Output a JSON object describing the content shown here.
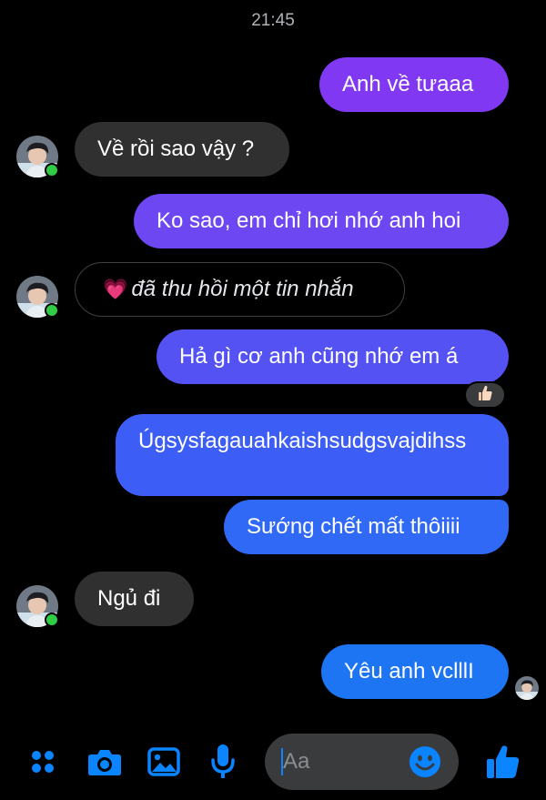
{
  "status": {
    "time": "21:45"
  },
  "messages": [
    {
      "id": "m1",
      "side": "outgoing",
      "text": "Anh về tưaaa"
    },
    {
      "id": "m2",
      "side": "incoming",
      "text": "Về rồi sao vậy ?"
    },
    {
      "id": "m3",
      "side": "outgoing",
      "text": "Ko sao, em chỉ hơi nhớ anh hoi"
    },
    {
      "id": "m4",
      "side": "incoming",
      "unsent": true,
      "emoji": "💗",
      "text": "đã thu hồi một tin nhắn"
    },
    {
      "id": "m5",
      "side": "outgoing",
      "text": "Hả gì cơ anh cũng nhớ em á",
      "reaction": "thumbs-up"
    },
    {
      "id": "m6",
      "side": "outgoing",
      "text": "Úgsysfagauahkaishsudgsvajdihss"
    },
    {
      "id": "m7",
      "side": "outgoing",
      "text": "Sướng chết mất thôiiii"
    },
    {
      "id": "m8",
      "side": "incoming",
      "text": "Ngủ đi"
    },
    {
      "id": "m9",
      "side": "outgoing",
      "text": "Yêu anh vclllI"
    }
  ],
  "composer": {
    "placeholder": "Aa"
  },
  "toolbar": {
    "icons": [
      "menu-grid-icon",
      "camera-icon",
      "gallery-icon",
      "microphone-icon",
      "emoji-icon",
      "like-icon"
    ]
  },
  "colors": {
    "bubble_gradient_top": "#8a38f5",
    "bubble_gradient_bottom": "#1877f2",
    "incoming_bubble": "#303030",
    "accent_blue": "#0a84ff",
    "online_green": "#31cc46",
    "background": "#000000"
  }
}
